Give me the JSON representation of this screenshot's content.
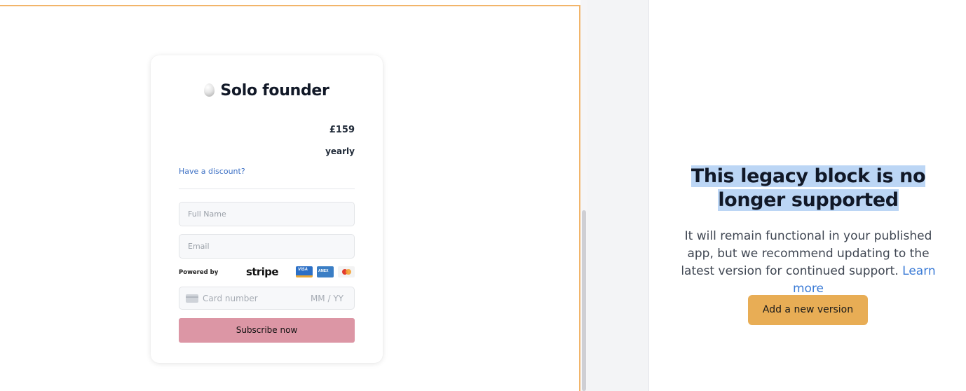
{
  "checkout": {
    "plan_title": "Solo founder",
    "price": "£159",
    "period": "yearly",
    "discount_link": "Have a discount?",
    "full_name_placeholder": "Full Name",
    "email_placeholder": "Email",
    "powered_by": "Powered by",
    "stripe_logo": "stripe",
    "card_brands": [
      "visa-card-icon",
      "amex-card-icon",
      "mastercard-card-icon"
    ],
    "card_number_placeholder": "Card number",
    "expiry_placeholder": "MM / YY",
    "subscribe_label": "Subscribe now",
    "subscribe_color": "#dc96a5"
  },
  "legacy_notice": {
    "title": "This legacy block is no longer supported",
    "body": "It will remain functional in your published app, but we recommend updating to the latest version for continued support.",
    "learn_more": "Learn more",
    "add_button": "Add a new version",
    "accent_color": "#e8ad55"
  }
}
